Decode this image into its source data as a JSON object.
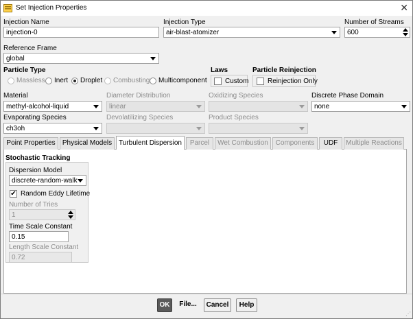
{
  "window": {
    "title": "Set Injection Properties",
    "close_glyph": "✕"
  },
  "header": {
    "injection_name_label": "Injection Name",
    "injection_name_value": "injection-0",
    "injection_type_label": "Injection Type",
    "injection_type_value": "air-blast-atomizer",
    "num_streams_label": "Number of Streams",
    "num_streams_value": "600",
    "reference_frame_label": "Reference Frame",
    "reference_frame_value": "global"
  },
  "particle_type": {
    "label": "Particle Type",
    "options": [
      {
        "label": "Massless",
        "selected": false,
        "enabled": false
      },
      {
        "label": "Inert",
        "selected": false,
        "enabled": true
      },
      {
        "label": "Droplet",
        "selected": true,
        "enabled": true
      },
      {
        "label": "Combusting",
        "selected": false,
        "enabled": false
      },
      {
        "label": "Multicomponent",
        "selected": false,
        "enabled": true
      }
    ]
  },
  "laws": {
    "label": "Laws",
    "custom_label": "Custom",
    "custom_checked": false
  },
  "reinjection": {
    "label": "Particle Reinjection",
    "only_label": "Reinjection Only",
    "only_checked": false
  },
  "material": {
    "material_label": "Material",
    "material_value": "methyl-alcohol-liquid",
    "diameter_label": "Diameter Distribution",
    "diameter_value": "linear",
    "oxidizing_label": "Oxidizing Species",
    "oxidizing_value": "",
    "domain_label": "Discrete Phase Domain",
    "domain_value": "none",
    "evaporating_label": "Evaporating Species",
    "evaporating_value": "ch3oh",
    "devolatilizing_label": "Devolatilizing Species",
    "devolatilizing_value": "",
    "product_label": "Product Species",
    "product_value": ""
  },
  "tabs": [
    {
      "label": "Point Properties",
      "active": false,
      "enabled": true
    },
    {
      "label": "Physical Models",
      "active": false,
      "enabled": true
    },
    {
      "label": "Turbulent Dispersion",
      "active": true,
      "enabled": true
    },
    {
      "label": "Parcel",
      "active": false,
      "enabled": false
    },
    {
      "label": "Wet Combustion",
      "active": false,
      "enabled": false
    },
    {
      "label": "Components",
      "active": false,
      "enabled": false
    },
    {
      "label": "UDF",
      "active": false,
      "enabled": true
    },
    {
      "label": "Multiple Reactions",
      "active": false,
      "enabled": false
    }
  ],
  "stochastic": {
    "title": "Stochastic Tracking",
    "model_label": "Dispersion Model",
    "model_value": "discrete-random-walk",
    "eddy_label": "Random Eddy Lifetime",
    "eddy_checked": true,
    "tries_label": "Number of Tries",
    "tries_value": "1",
    "time_scale_label": "Time Scale Constant",
    "time_scale_value": "0.15",
    "length_scale_label": "Length Scale Constant",
    "length_scale_value": "0.72"
  },
  "footer": {
    "ok_label": "OK",
    "file_label": "File...",
    "cancel_label": "Cancel",
    "help_label": "Help"
  },
  "check_glyph": "✔",
  "grip_glyph": "⋰"
}
